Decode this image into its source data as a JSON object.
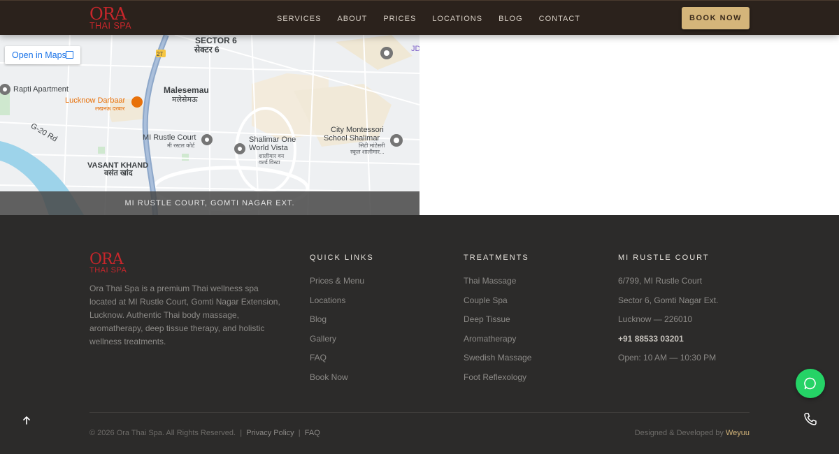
{
  "brand": {
    "name": "ORA",
    "sub": "THAI SPA"
  },
  "nav": {
    "links": [
      "SERVICES",
      "ABOUT",
      "PRICES",
      "LOCATIONS",
      "BLOG",
      "CONTACT"
    ],
    "cta": "BOOK NOW"
  },
  "map": {
    "open_label": "Open in Maps",
    "caption": "MI RUSTLE COURT, GOMTI NAGAR EXT.",
    "labels": {
      "sector": "SECTOR 6",
      "sector_hi": "सेक्टर 6",
      "rapti": "Rapti Apartment",
      "darbaar": "Lucknow Darbaar",
      "darbaar_hi": "लखनऊ दरबार",
      "malesemau": "Malesemau",
      "malesemau_hi": "मलेसेमऊ",
      "g20": "G-20 Rd",
      "mi_rustle": "MI Rustle Court",
      "mi_rustle_hi": "मी रस्टल कोर्ट",
      "shalimar": "Shalimar One",
      "shalimar2": "World Vista",
      "shalimar_hi": "शालीमार वन",
      "shalimar_hi2": "वर्ल्ड विस्टा",
      "city_montessori": "City Montessori",
      "school": "School Shalimar",
      "school_hi": "सिटी मांटेसरी",
      "school_hi2": "स्कूल शालीमार...",
      "vasant": "VASANT KHAND",
      "vasant_hi": "वसंत खांद",
      "road27": "27",
      "jd": "JD"
    }
  },
  "footer": {
    "description": "Ora Thai Spa is a premium Thai wellness spa located at MI Rustle Court, Gomti Nagar Extension, Lucknow. Authentic Thai body massage, aromatherapy, deep tissue therapy, and holistic wellness treatments.",
    "quick_links": {
      "title": "QUICK LINKS",
      "items": [
        "Prices & Menu",
        "Locations",
        "Blog",
        "Gallery",
        "FAQ",
        "Book Now"
      ]
    },
    "treatments": {
      "title": "TREATMENTS",
      "items": [
        "Thai Massage",
        "Couple Spa",
        "Deep Tissue",
        "Aromatherapy",
        "Swedish Massage",
        "Foot Reflexology"
      ]
    },
    "location": {
      "title": "MI RUSTLE COURT",
      "address1": "6/799, MI Rustle Court",
      "address2": "Sector 6, Gomti Nagar Ext.",
      "address3": "Lucknow — 226010",
      "phone": "+91 88533 03201",
      "hours": "Open: 10 AM — 10:30 PM"
    },
    "copyright": "© 2026 Ora Thai Spa. All Rights Reserved.",
    "sep": "|",
    "privacy": "Privacy Policy",
    "faq": "FAQ",
    "credit_prefix": "Designed & Developed by",
    "credit_brand": "Weyuu"
  },
  "colors": {
    "brand_red": "#c8262b",
    "gold": "#d4b57a",
    "whatsapp": "#25d366"
  }
}
